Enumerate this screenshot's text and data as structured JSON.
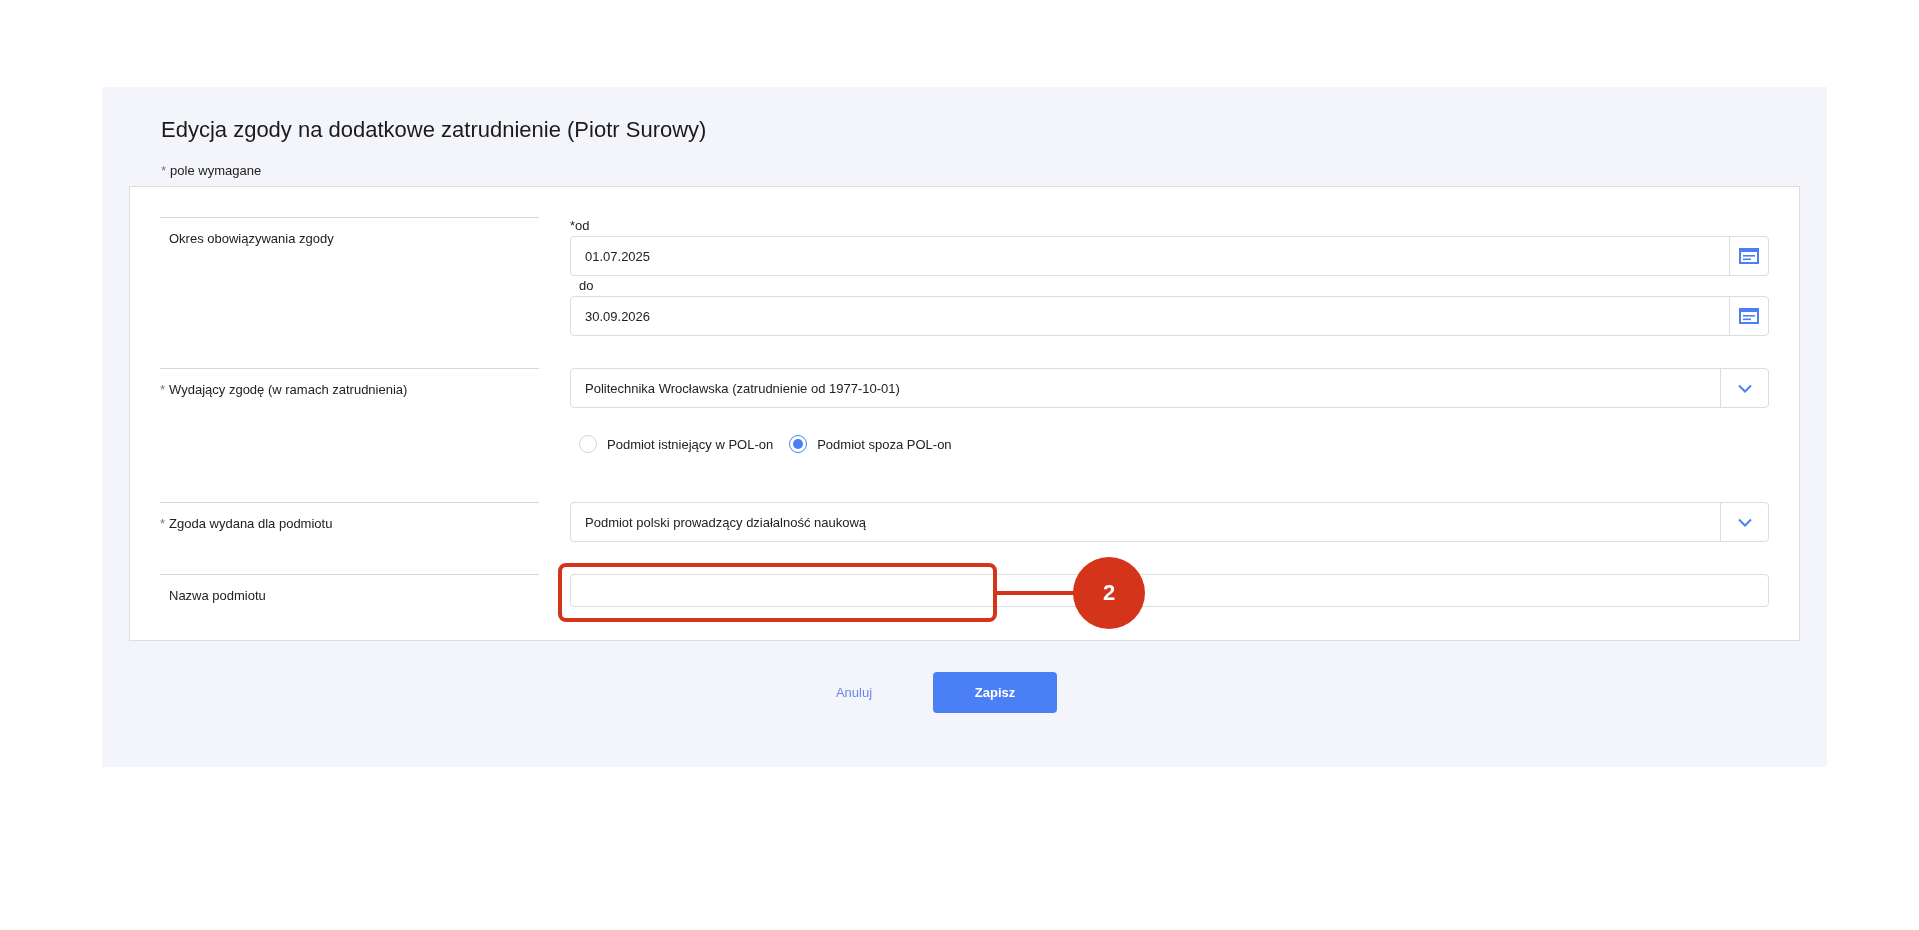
{
  "title": "Edycja zgody na dodatkowe zatrudnienie (Piotr Surowy)",
  "required_note": {
    "mark": "*",
    "text": "pole wymagane"
  },
  "rows": [
    {
      "kind": "date_range",
      "label": "Okres obowiązywania zgody",
      "fields": [
        {
          "label": "*od",
          "value": "01.07.2025"
        },
        {
          "label": "do",
          "value": "30.09.2026"
        }
      ]
    },
    {
      "kind": "select",
      "mark": "*",
      "label": "Wydający zgodę (w ramach zatrudnienia)",
      "value": "Politechnika Wrocławska (zatrudnienie od 1977-10-01)",
      "radios": [
        {
          "label": "Podmiot istniejący w POL-on",
          "selected": false
        },
        {
          "label": "Podmiot spoza POL-on",
          "selected": true
        }
      ]
    },
    {
      "kind": "select",
      "mark": "*",
      "label": "Zgoda wydana dla podmiotu",
      "value": "Podmiot polski prowadzący działalność naukową"
    },
    {
      "kind": "text",
      "label": "Nazwa podmiotu",
      "annotation": "2"
    }
  ],
  "buttons": {
    "cancel": "Anuluj",
    "save": "Zapisz"
  }
}
